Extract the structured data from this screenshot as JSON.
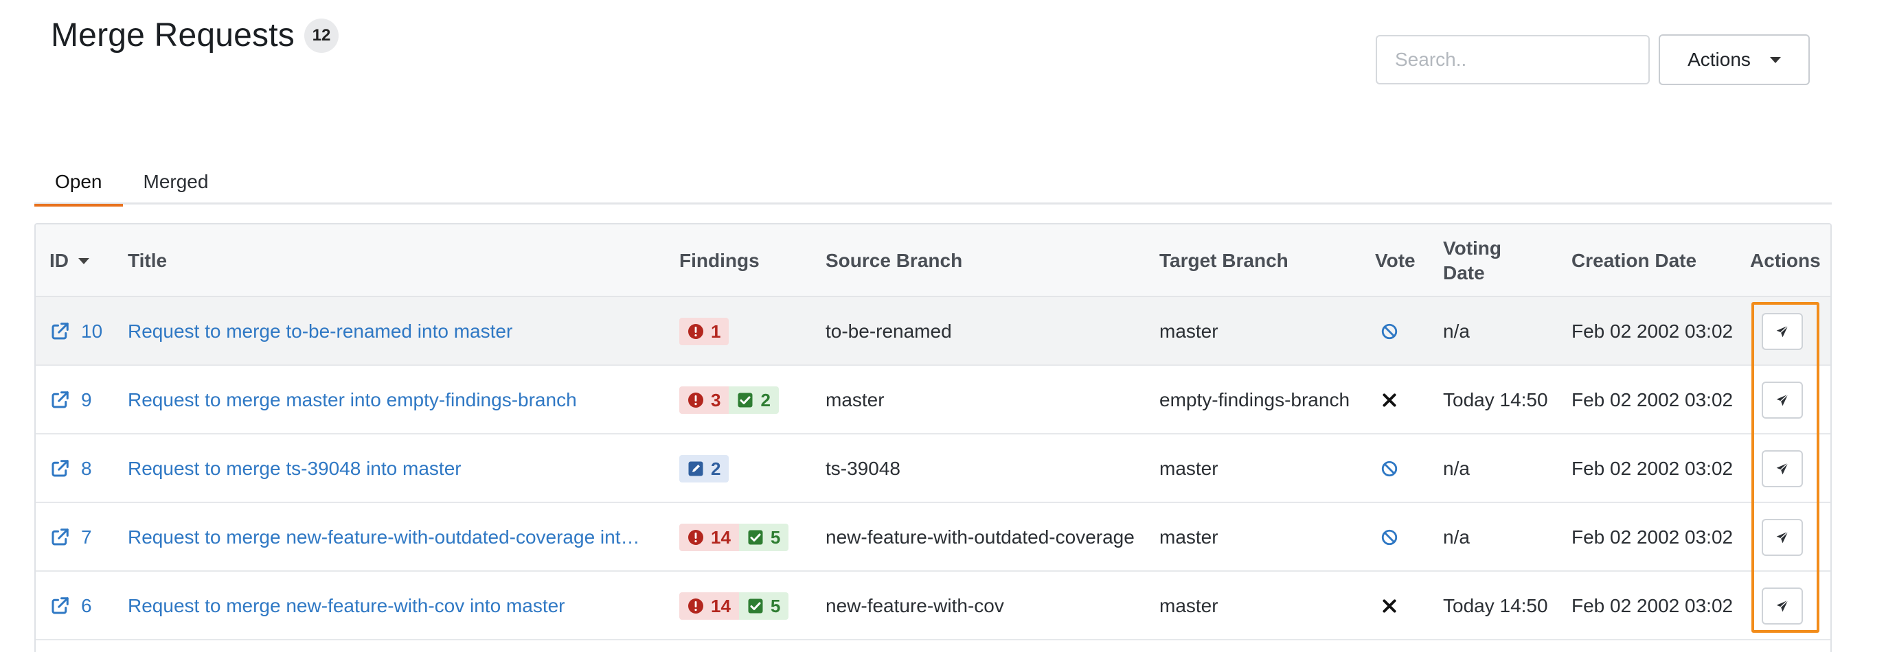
{
  "header": {
    "title": "Merge Requests",
    "count": "12",
    "search_placeholder": "Search..",
    "actions_label": "Actions"
  },
  "tabs": [
    {
      "label": "Open",
      "active": true
    },
    {
      "label": "Merged",
      "active": false
    }
  ],
  "table": {
    "columns": {
      "id": "ID",
      "title": "Title",
      "findings": "Findings",
      "source": "Source Branch",
      "target": "Target Branch",
      "vote": "Vote",
      "voting_date_line1": "Voting",
      "voting_date_line2": "Date",
      "creation_date": "Creation Date",
      "actions": "Actions"
    },
    "rows": [
      {
        "id": "10",
        "title": "Request to merge to-be-renamed into master",
        "findings": [
          {
            "kind": "red",
            "icon": "exclamation-circle-icon",
            "count": "1"
          }
        ],
        "source": "to-be-renamed",
        "target": "master",
        "vote": "ban-icon",
        "voting_date": "n/a",
        "creation_date": "Feb 02 2002 03:02"
      },
      {
        "id": "9",
        "title": "Request to merge master into empty-findings-branch",
        "findings": [
          {
            "kind": "red",
            "icon": "exclamation-circle-icon",
            "count": "3"
          },
          {
            "kind": "green",
            "icon": "check-square-icon",
            "count": "2"
          }
        ],
        "source": "master",
        "target": "empty-findings-branch",
        "vote": "x-mark-icon",
        "voting_date": "Today 14:50",
        "creation_date": "Feb 02 2002 03:02"
      },
      {
        "id": "8",
        "title": "Request to merge ts-39048 into master",
        "findings": [
          {
            "kind": "blue",
            "icon": "pencil-square-icon",
            "count": "2"
          }
        ],
        "source": "ts-39048",
        "target": "master",
        "vote": "ban-icon",
        "voting_date": "n/a",
        "creation_date": "Feb 02 2002 03:02"
      },
      {
        "id": "7",
        "title": "Request to merge new-feature-with-outdated-coverage int…",
        "findings": [
          {
            "kind": "red",
            "icon": "exclamation-circle-icon",
            "count": "14"
          },
          {
            "kind": "green",
            "icon": "check-square-icon",
            "count": "5"
          }
        ],
        "source": "new-feature-with-outdated-coverage",
        "target": "master",
        "vote": "ban-icon",
        "voting_date": "n/a",
        "creation_date": "Feb 02 2002 03:02"
      },
      {
        "id": "6",
        "title": "Request to merge new-feature-with-cov into master",
        "findings": [
          {
            "kind": "red",
            "icon": "exclamation-circle-icon",
            "count": "14"
          },
          {
            "kind": "green",
            "icon": "check-square-icon",
            "count": "5"
          }
        ],
        "source": "new-feature-with-cov",
        "target": "master",
        "vote": "x-mark-icon",
        "voting_date": "Today 14:50",
        "creation_date": "Feb 02 2002 03:02"
      }
    ]
  },
  "colors": {
    "link": "#2f78c4",
    "tab_accent": "#e8721e",
    "highlight": "#f28c1a",
    "finding_red": "#b3261e",
    "finding_green": "#2e7d32",
    "finding_blue": "#2f5f9f",
    "vote_ban": "#2f78c4"
  }
}
